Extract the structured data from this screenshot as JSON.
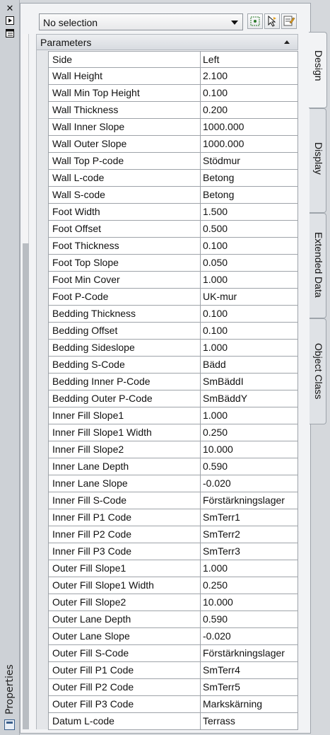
{
  "window": {
    "title": "Properties",
    "icons": [
      "close-icon",
      "auto-hide-icon",
      "properties-menu-icon"
    ]
  },
  "toolbar": {
    "selection": "No selection",
    "buttons": [
      "select-objects-icon",
      "quick-select-icon",
      "pickadd-toggle-icon"
    ]
  },
  "group": {
    "title": "Parameters"
  },
  "tabs": [
    "Design",
    "Display",
    "Extended Data",
    "Object Class"
  ],
  "rows": [
    {
      "name": "Side",
      "value": "Left"
    },
    {
      "name": "Wall Height",
      "value": "2.100"
    },
    {
      "name": "Wall Min Top Height",
      "value": "0.100"
    },
    {
      "name": "Wall Thickness",
      "value": "0.200"
    },
    {
      "name": "Wall Inner Slope",
      "value": "1000.000"
    },
    {
      "name": "Wall Outer Slope",
      "value": "1000.000"
    },
    {
      "name": "Wall Top P-code",
      "value": "Stödmur"
    },
    {
      "name": "Wall L-code",
      "value": "Betong"
    },
    {
      "name": "Wall S-code",
      "value": "Betong"
    },
    {
      "name": "Foot Width",
      "value": "1.500"
    },
    {
      "name": "Foot Offset",
      "value": "0.500"
    },
    {
      "name": "Foot Thickness",
      "value": "0.100"
    },
    {
      "name": "Foot Top Slope",
      "value": "0.050"
    },
    {
      "name": "Foot Min Cover",
      "value": "1.000"
    },
    {
      "name": "Foot P-Code",
      "value": "UK-mur"
    },
    {
      "name": "Bedding Thickness",
      "value": "0.100"
    },
    {
      "name": "Bedding Offset",
      "value": "0.100"
    },
    {
      "name": "Bedding Sideslope",
      "value": "1.000"
    },
    {
      "name": "Bedding S-Code",
      "value": "Bädd"
    },
    {
      "name": "Bedding Inner P-Code",
      "value": "SmBäddI"
    },
    {
      "name": "Bedding Outer P-Code",
      "value": "SmBäddY"
    },
    {
      "name": "Inner Fill Slope1",
      "value": "1.000"
    },
    {
      "name": "Inner Fill Slope1 Width",
      "value": "0.250"
    },
    {
      "name": "Inner Fill Slope2",
      "value": "10.000"
    },
    {
      "name": "Inner Lane Depth",
      "value": "0.590"
    },
    {
      "name": "Inner Lane Slope",
      "value": "-0.020"
    },
    {
      "name": "Inner Fill S-Code",
      "value": "Förstärkningslager"
    },
    {
      "name": "Inner Fill P1 Code",
      "value": "SmTerr1"
    },
    {
      "name": "Inner Fill P2 Code",
      "value": "SmTerr2"
    },
    {
      "name": "Inner Fill P3 Code",
      "value": "SmTerr3"
    },
    {
      "name": "Outer Fill Slope1",
      "value": "1.000"
    },
    {
      "name": "Outer Fill Slope1 Width",
      "value": "0.250"
    },
    {
      "name": "Outer Fill Slope2",
      "value": "10.000"
    },
    {
      "name": "Outer Lane Depth",
      "value": "0.590"
    },
    {
      "name": "Outer Lane Slope",
      "value": "-0.020"
    },
    {
      "name": "Outer Fill S-Code",
      "value": "Förstärkningslager"
    },
    {
      "name": "Outer Fill P1 Code",
      "value": "SmTerr4"
    },
    {
      "name": "Outer Fill P2 Code",
      "value": "SmTerr5"
    },
    {
      "name": "Outer Fill P3 Code",
      "value": "Markskärning"
    },
    {
      "name": "Datum L-code",
      "value": "Terrass"
    }
  ]
}
